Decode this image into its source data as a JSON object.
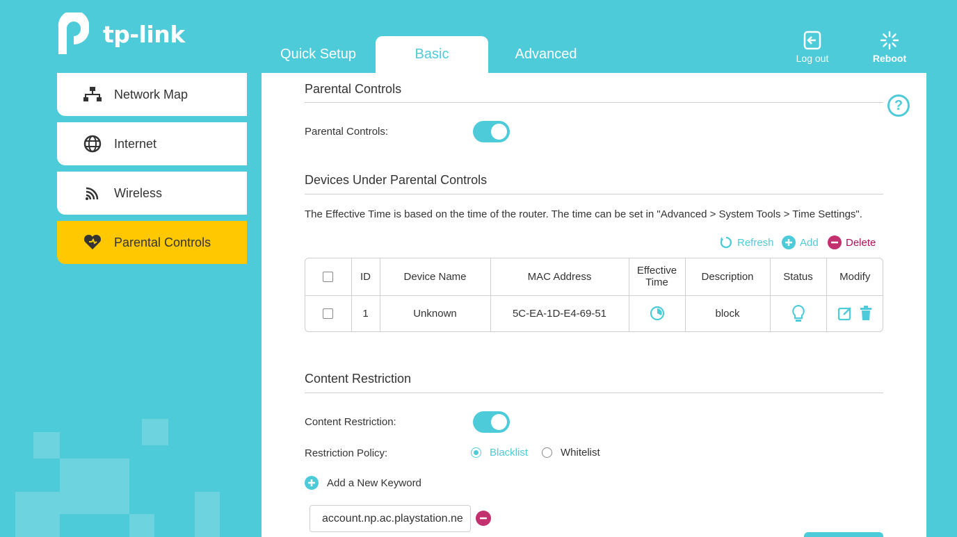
{
  "brand": {
    "name": "tp-link"
  },
  "tabs": [
    {
      "label": "Quick Setup"
    },
    {
      "label": "Basic"
    },
    {
      "label": "Advanced"
    }
  ],
  "top_actions": {
    "logout": "Log out",
    "reboot": "Reboot"
  },
  "sidebar": {
    "items": [
      {
        "label": "Network Map"
      },
      {
        "label": "Internet"
      },
      {
        "label": "Wireless"
      },
      {
        "label": "Parental Controls"
      }
    ]
  },
  "parental": {
    "title": "Parental Controls",
    "toggle_label": "Parental Controls:"
  },
  "devices": {
    "title": "Devices Under Parental Controls",
    "note": "The Effective Time is based on the time of the router. The time can be set in \"Advanced > System Tools > Time Settings\".",
    "actions": {
      "refresh": "Refresh",
      "add": "Add",
      "delete": "Delete"
    },
    "columns": {
      "id": "ID",
      "device_name": "Device Name",
      "mac": "MAC Address",
      "effective_time": "Effective Time",
      "description": "Description",
      "status": "Status",
      "modify": "Modify"
    },
    "rows": [
      {
        "id": "1",
        "device_name": "Unknown",
        "mac": "5C-EA-1D-E4-69-51",
        "description": "block"
      }
    ]
  },
  "content": {
    "title": "Content Restriction",
    "toggle_label": "Content Restriction:",
    "policy_label": "Restriction Policy:",
    "policy_options": {
      "blacklist": "Blacklist",
      "whitelist": "Whitelist"
    },
    "add_keyword": "Add a New Keyword",
    "keyword_value": "account.np.ac.playstation.ne"
  },
  "colors": {
    "accent": "#4ecbd8",
    "active_nav": "#ffc800",
    "danger": "#a8145a"
  }
}
